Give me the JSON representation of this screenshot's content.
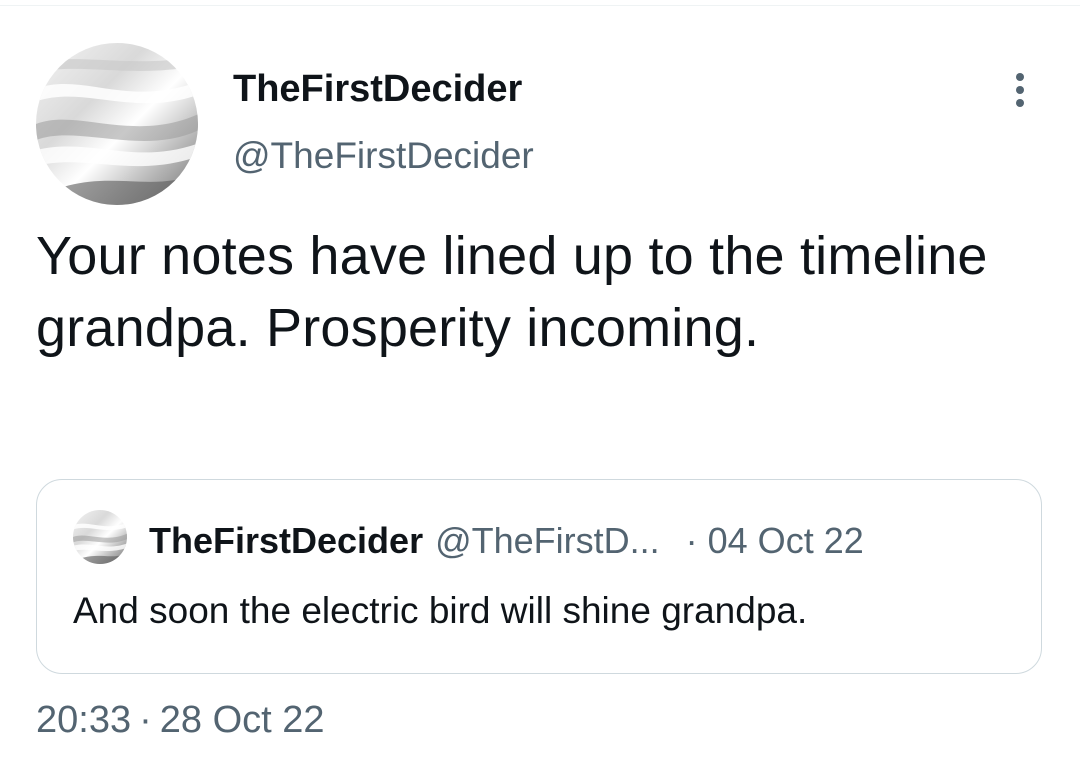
{
  "tweet": {
    "author": {
      "display_name": "TheFirstDecider",
      "handle": "@TheFirstDecider",
      "avatar_icon": "silk-avatar"
    },
    "menu_icon": "more-vertical-icon",
    "text": "Your notes have lined up to the timeline grandpa. Prosperity incoming.",
    "time": "20:33",
    "separator": "·",
    "date": "28 Oct 22"
  },
  "quote": {
    "author": {
      "display_name": "TheFirstDecider",
      "handle": "@TheFirstD...",
      "avatar_icon": "silk-avatar"
    },
    "separator": "·",
    "date": "04 Oct 22",
    "text": "And soon the electric bird will shine grandpa."
  },
  "colors": {
    "text_primary": "#0f1419",
    "text_secondary": "#536471",
    "border": "#cfd9de"
  }
}
